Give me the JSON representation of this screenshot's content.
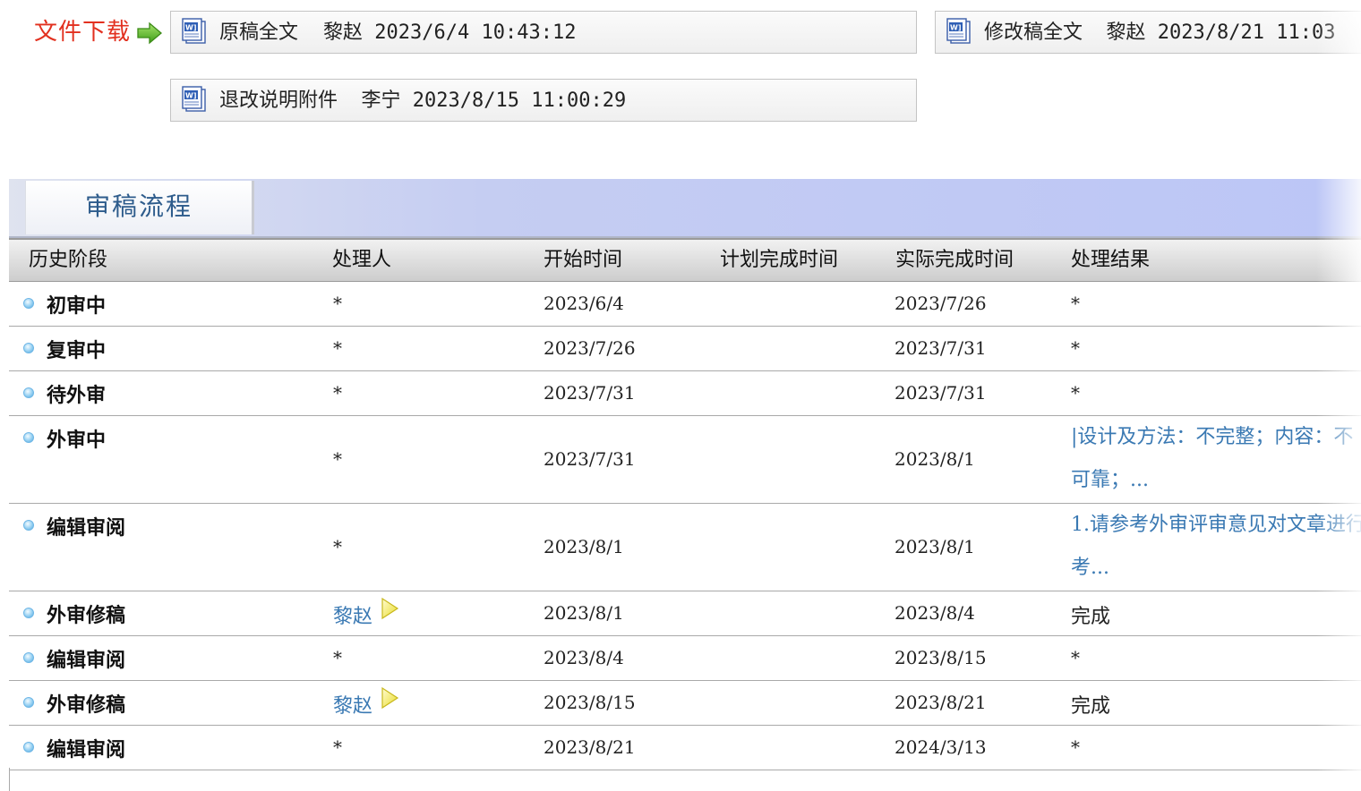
{
  "downloads": {
    "label": "文件下载",
    "files": [
      {
        "name": "原稿全文",
        "user": "黎赵",
        "time": "2023/6/4 10:43:12"
      },
      {
        "name": "修改稿全文",
        "user": "黎赵",
        "time": "2023/8/21 11:03"
      },
      {
        "name": "退改说明附件",
        "user": "李宁",
        "time": "2023/8/15 11:00:29"
      }
    ]
  },
  "tab": {
    "label": "审稿流程"
  },
  "table": {
    "headers": [
      "历史阶段",
      "处理人",
      "开始时间",
      "计划完成时间",
      "实际完成时间",
      "处理结果"
    ],
    "rows": [
      {
        "stage": "初审中",
        "handler": "*",
        "start": "2023/6/4",
        "planned": "",
        "actual": "2023/7/26",
        "result": "*"
      },
      {
        "stage": "复审中",
        "handler": "*",
        "start": "2023/7/26",
        "planned": "",
        "actual": "2023/7/31",
        "result": "*"
      },
      {
        "stage": "待外审",
        "handler": "*",
        "start": "2023/7/31",
        "planned": "",
        "actual": "2023/7/31",
        "result": "*"
      },
      {
        "stage": "外审中",
        "handler": "*",
        "start": "2023/7/31",
        "planned": "",
        "actual": "2023/8/1",
        "result_line1": "|设计及方法：不完整；内容：不",
        "result_line2": "可靠；..."
      },
      {
        "stage": "编辑审阅",
        "handler": "*",
        "start": "2023/8/1",
        "planned": "",
        "actual": "2023/8/1",
        "result_line1": "1.请参考外审评审意见对文章进行",
        "result_line2": "考..."
      },
      {
        "stage": "外审修稿",
        "handler": "黎赵",
        "start": "2023/8/1",
        "planned": "",
        "actual": "2023/8/4",
        "result": "完成"
      },
      {
        "stage": "编辑审阅",
        "handler": "*",
        "start": "2023/8/4",
        "planned": "",
        "actual": "2023/8/15",
        "result": "*"
      },
      {
        "stage": "外审修稿",
        "handler": "黎赵",
        "start": "2023/8/15",
        "planned": "",
        "actual": "2023/8/21",
        "result": "完成"
      },
      {
        "stage": "编辑审阅",
        "handler": "*",
        "start": "2023/8/21",
        "planned": "",
        "actual": "2024/3/13",
        "result": "*"
      }
    ]
  },
  "icons": {
    "file": "word-document-icon",
    "arrow": "green-arrow-right-icon",
    "bullet": "blue-bullet-icon",
    "play": "yellow-play-icon"
  },
  "colors": {
    "label_red": "#e2301f",
    "link_blue": "#3a79b3",
    "tab_text": "#2e5c8c"
  }
}
